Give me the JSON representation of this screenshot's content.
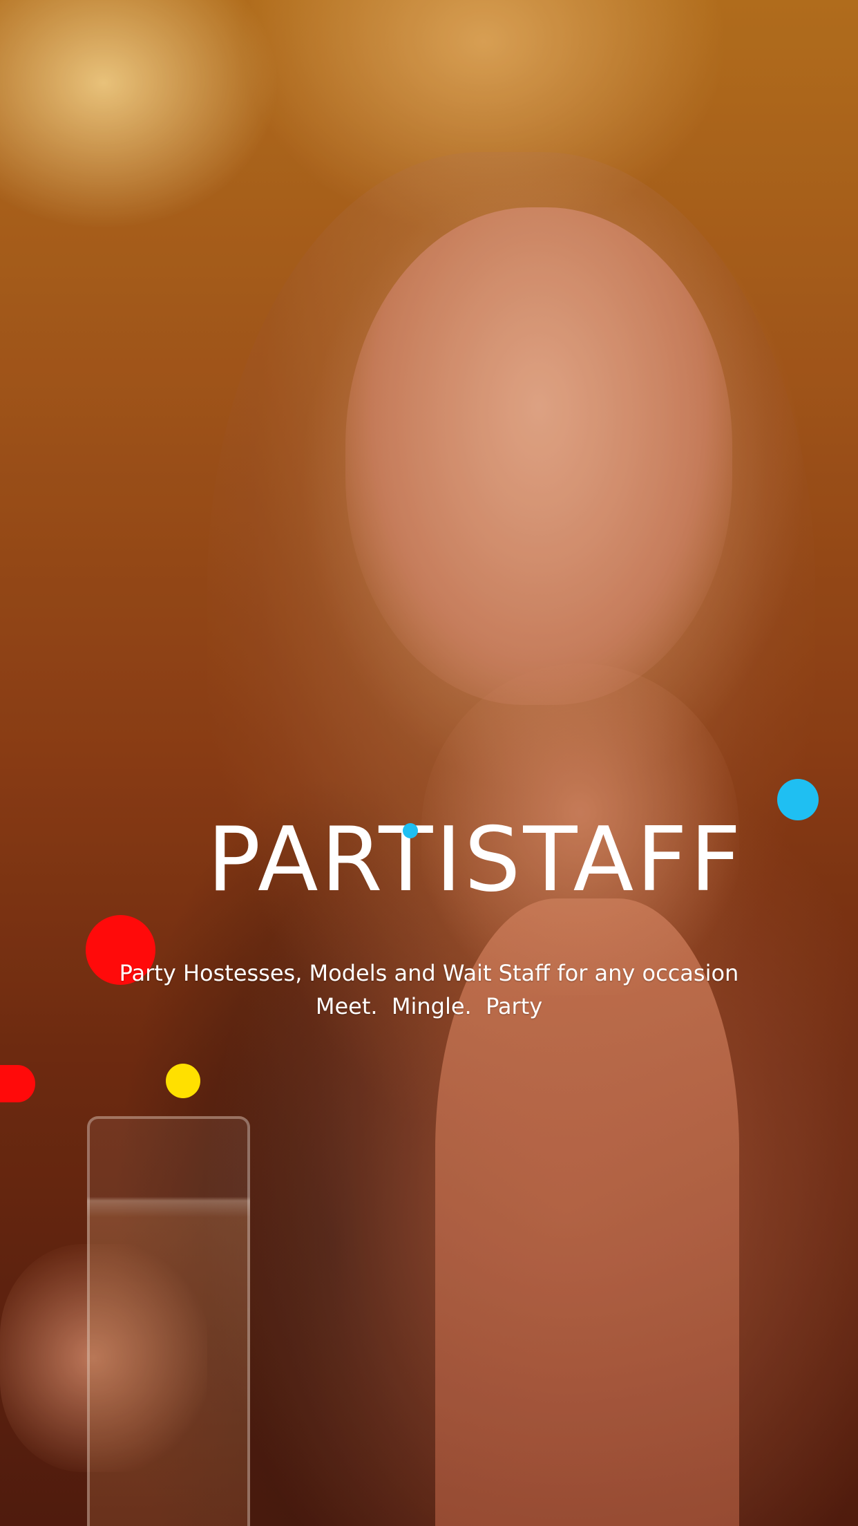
{
  "brand": {
    "name": "PARTISTAFF",
    "tagline": "Party Hostesses, Models and Wait Staff for any occasion",
    "motto": "Meet.  Mingle.  Party"
  },
  "colors": {
    "accent_blue": "#1fbff2",
    "accent_red": "#ff0a0a",
    "accent_yellow": "#ffe000",
    "text": "#ffffff"
  }
}
